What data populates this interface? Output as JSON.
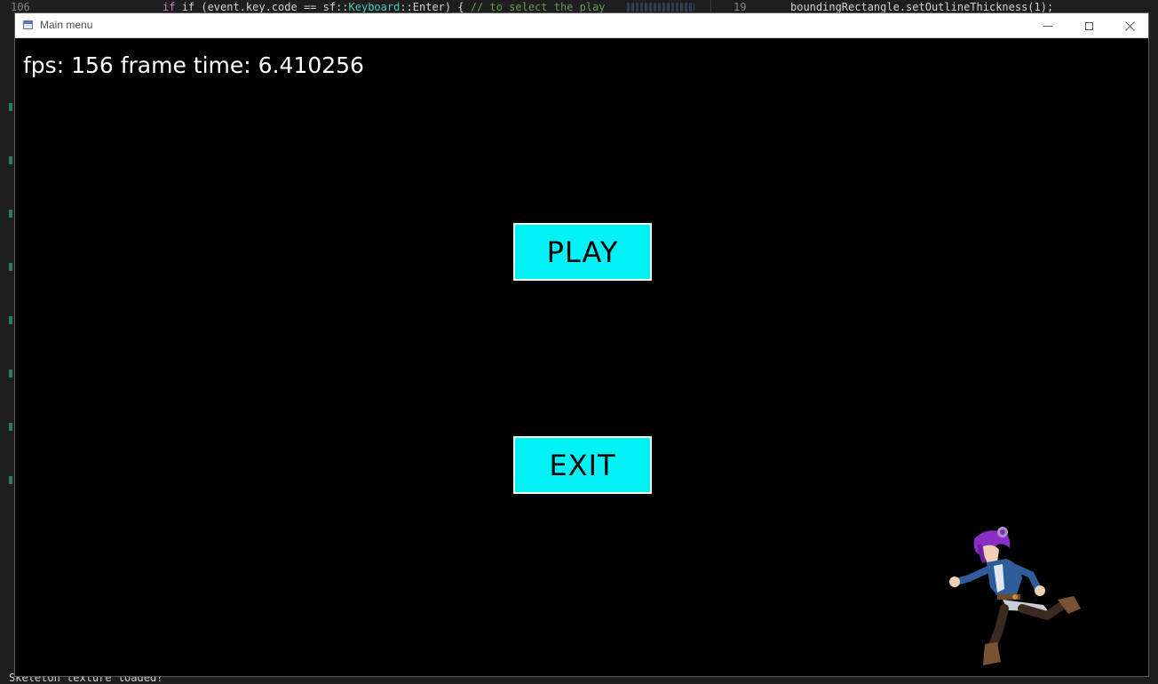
{
  "background_editor": {
    "left_line_number": "106",
    "left_code_prefix": "if (event.key.code == sf::",
    "left_code_type": "Keyboard",
    "left_code_mid": "::Enter) { ",
    "left_code_comment": "// to select the play",
    "right_line_number": "19",
    "right_code": "boundingRectangle.setOutlineThickness(1);",
    "terminal_line": "Skeleton texture loaded!"
  },
  "window": {
    "title": "Main menu",
    "icon": "app-window-icon",
    "controls": [
      "minimize",
      "maximize",
      "close"
    ]
  },
  "game": {
    "fps_text": "fps: 156 frame time: 6.410256",
    "buttons": {
      "play": "PLAY",
      "exit": "EXIT"
    },
    "colors": {
      "button_fill": "#00f2f4",
      "button_border": "#ffffff",
      "background": "#000000"
    },
    "sprite": "running-character-sprite"
  }
}
